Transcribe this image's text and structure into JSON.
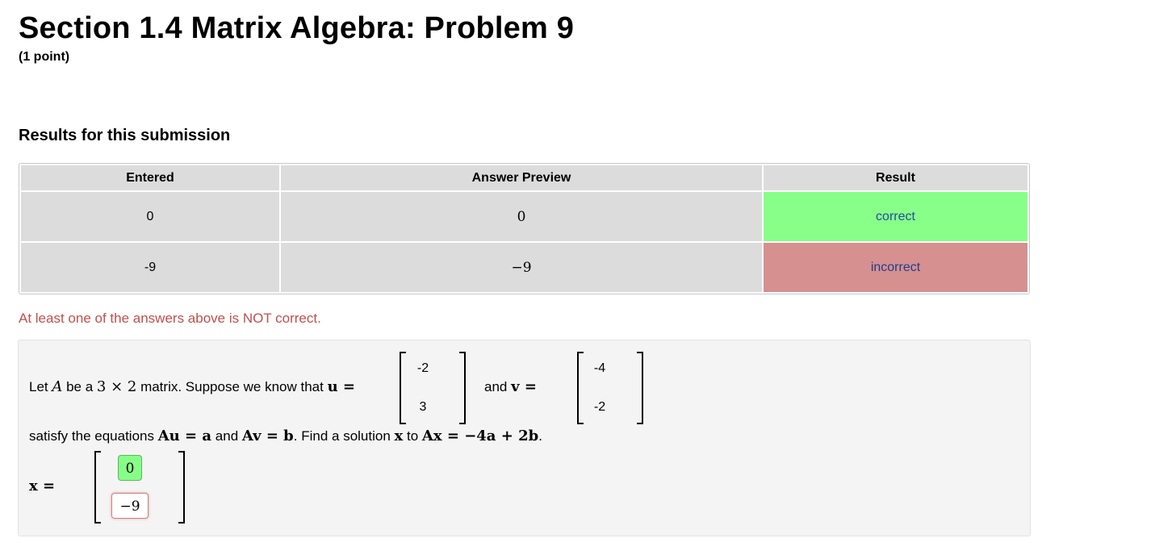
{
  "header": {
    "title": "Section 1.4 Matrix Algebra: Problem 9",
    "points": "(1 point)"
  },
  "results": {
    "heading": "Results for this submission",
    "columns": [
      "Entered",
      "Answer Preview",
      "Result"
    ],
    "rows": [
      {
        "entered": "0",
        "preview": "0",
        "result": "correct"
      },
      {
        "entered": "-9",
        "preview": "−9",
        "result": "incorrect"
      }
    ],
    "warning": "At least one of the answers above is NOT correct."
  },
  "problem": {
    "line1": {
      "t1": "Let ",
      "A": "A",
      "t2": " be a ",
      "dims": "3 × 2",
      "t3": " matrix. Suppose we know that ",
      "u_eq": "u =",
      "t4": "and ",
      "v_eq": "v ="
    },
    "u": [
      "-2",
      "3"
    ],
    "v": [
      "-4",
      "-2"
    ],
    "line2": {
      "t1": "satisfy the equations ",
      "eq1": "Au = a",
      "t2": " and ",
      "eq2": "Av = b",
      "t3": ". Find a solution ",
      "x": "x",
      "t4": " to ",
      "eq3": "Ax = −4a + 2b",
      "t5": "."
    },
    "x_label": "x =",
    "answers": [
      "0",
      "−9"
    ]
  },
  "colors": {
    "correct": "#88ff88",
    "incorrect": "#d69090",
    "warning": "#c0504d"
  }
}
